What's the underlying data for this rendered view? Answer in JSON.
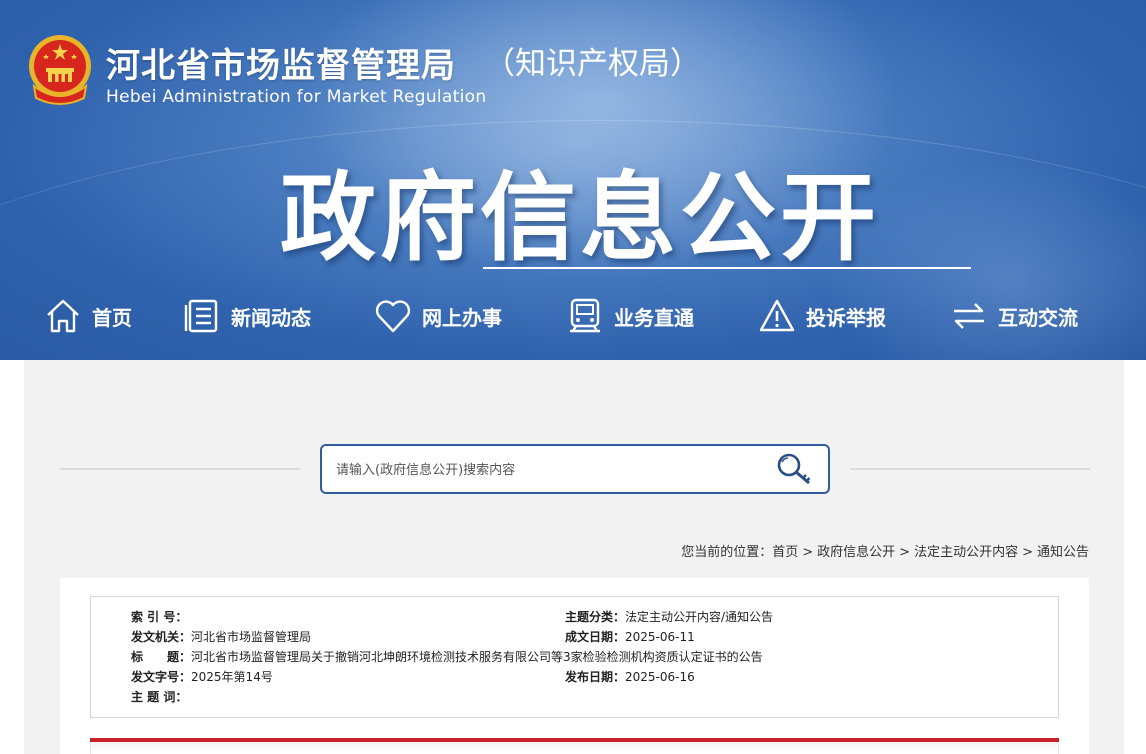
{
  "header": {
    "title": "河北省市场监督管理局",
    "subtitle": "（知识产权局）",
    "english": "Hebei Administration for Market Regulation",
    "banner": "政府信息公开",
    "colors": {
      "background": "#3a6db5",
      "text": "#ffffff"
    }
  },
  "nav": {
    "items": [
      {
        "label": "首页",
        "icon": "home-icon"
      },
      {
        "label": "新闻动态",
        "icon": "document-icon"
      },
      {
        "label": "网上办事",
        "icon": "heart-icon"
      },
      {
        "label": "业务直通",
        "icon": "train-icon"
      },
      {
        "label": "投诉举报",
        "icon": "warning-icon"
      },
      {
        "label": "互动交流",
        "icon": "exchange-icon"
      }
    ]
  },
  "search": {
    "placeholder": "请输入(政府信息公开)搜索内容",
    "value": "",
    "icon": "search-key-icon"
  },
  "breadcrumb": {
    "prefix": "您当前的位置：",
    "items": [
      "首页",
      "政府信息公开",
      "法定主动公开内容",
      "通知公告"
    ],
    "separator": ">"
  },
  "meta": {
    "index_label": "索 引 号：",
    "index_value": "",
    "category_label": "主题分类：",
    "category_value": "法定主动公开内容/通知公告",
    "issuer_label": "发文机关：",
    "issuer_value": "河北省市场监督管理局",
    "created_label": "成文日期：",
    "created_value": "2025-06-11",
    "title_label": "标　　题：",
    "title_value": "河北省市场监督管理局关于撤销河北坤朗环境检测技术服务有限公司等3家检验检测机构资质认定证书的公告",
    "docno_label": "发文字号：",
    "docno_value": "2025年第14号",
    "published_label": "发布日期：",
    "published_value": "2025-06-16",
    "keywords_label": "主 题 词：",
    "keywords_value": ""
  },
  "colors": {
    "accent_red": "#c9202a",
    "search_border": "#2f5d9e",
    "content_bg": "#f2f2f2"
  }
}
